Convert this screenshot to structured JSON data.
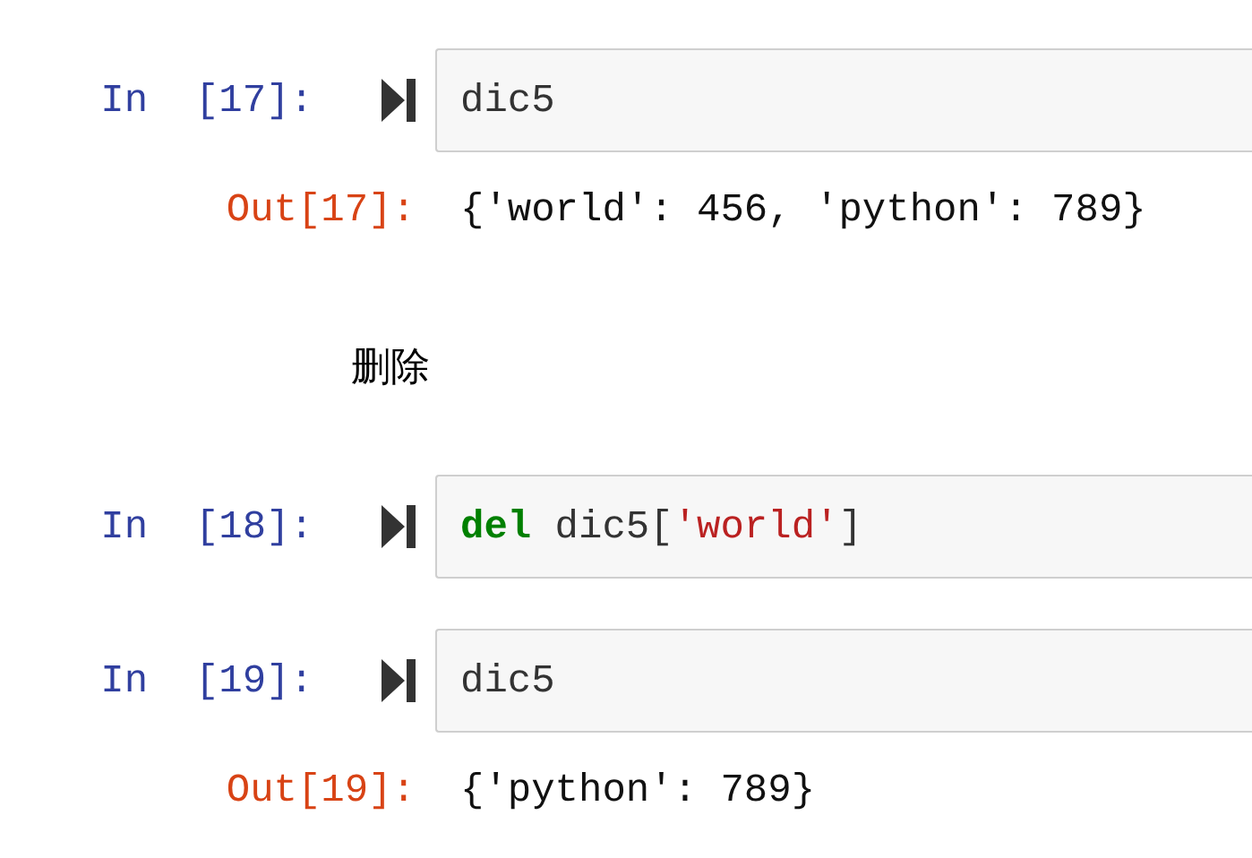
{
  "cells": [
    {
      "kind": "code",
      "prompt": "In  [17]:",
      "tokens": [
        {
          "kind": "name",
          "text": "dic5"
        }
      ],
      "output": {
        "prompt": "Out[17]:",
        "text": "{'world': 456, 'python': 789}"
      }
    },
    {
      "kind": "markdown",
      "text": "删除"
    },
    {
      "kind": "code",
      "prompt": "In  [18]:",
      "tokens": [
        {
          "kind": "keyword",
          "text": "del"
        },
        {
          "kind": "name",
          "text": " dic5["
        },
        {
          "kind": "string",
          "text": "'world'"
        },
        {
          "kind": "name",
          "text": "]"
        }
      ]
    },
    {
      "kind": "code",
      "prompt": "In  [19]:",
      "tokens": [
        {
          "kind": "name",
          "text": "dic5"
        }
      ],
      "output": {
        "prompt": "Out[19]:",
        "text": "{'python': 789}"
      }
    }
  ]
}
